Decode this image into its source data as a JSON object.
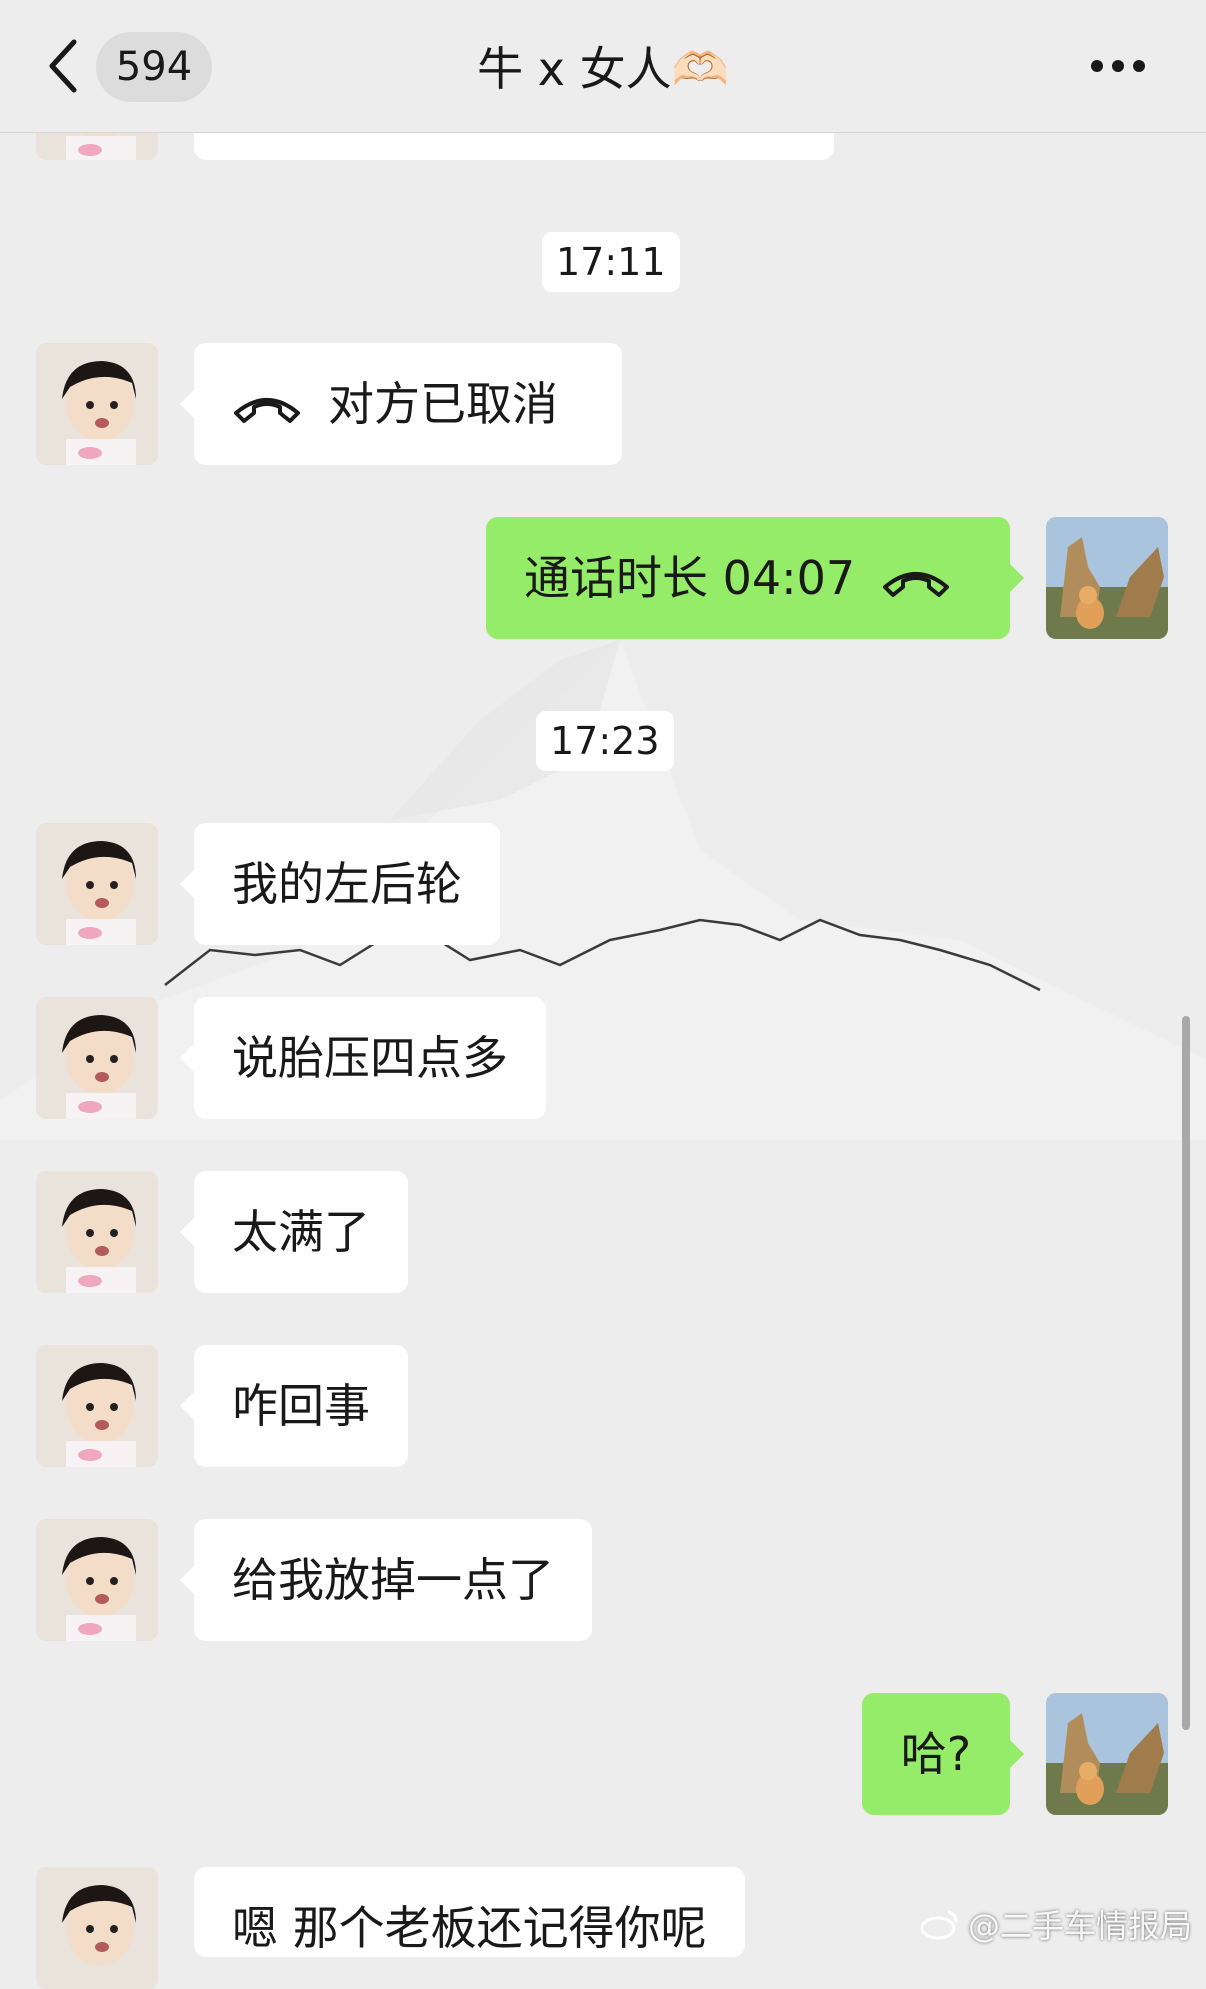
{
  "header": {
    "back_icon": "chevron-left-icon",
    "unread_count": "594",
    "title": "牛 x 女人🫶🏻",
    "more_icon": "more-dots-icon"
  },
  "messages": [
    {
      "type": "time",
      "text": "17:11"
    },
    {
      "side": "left",
      "icon": "phone-hangup-icon",
      "text": "对方已取消"
    },
    {
      "side": "right",
      "icon": "phone-hangup-icon",
      "text": "通话时长 04:07"
    },
    {
      "type": "time",
      "text": "17:23"
    },
    {
      "side": "left",
      "text": "我的左后轮"
    },
    {
      "side": "left",
      "text": "说胎压四点多"
    },
    {
      "side": "left",
      "text": "太满了"
    },
    {
      "side": "left",
      "text": "咋回事"
    },
    {
      "side": "left",
      "text": "给我放掉一点了"
    },
    {
      "side": "right",
      "text": "哈?"
    },
    {
      "side": "left",
      "text": "嗯 那个老板还记得你呢"
    }
  ],
  "watermark": "@二手车情报局",
  "colors": {
    "background": "#ededed",
    "bubble_self": "#95ec69",
    "bubble_other": "#ffffff"
  }
}
